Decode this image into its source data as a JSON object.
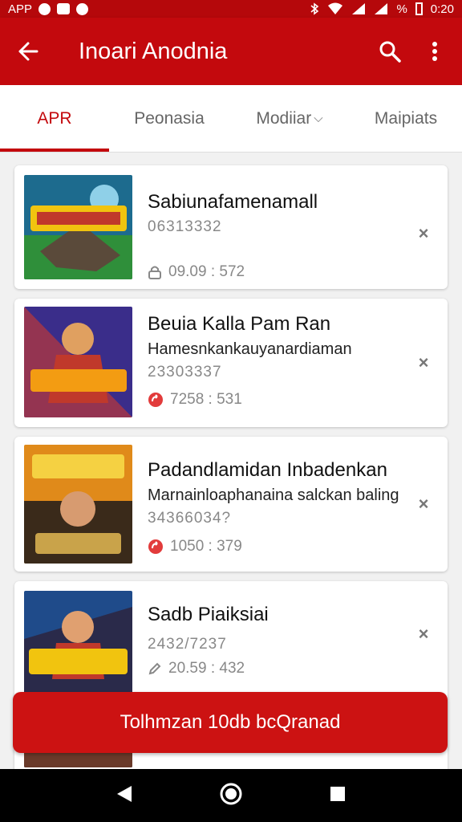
{
  "status_bar": {
    "app_label": "APP",
    "percent": "%",
    "time": "0:20"
  },
  "app_bar": {
    "title": "Inoari Anodnia",
    "back_icon": "arrow-left-icon",
    "search_icon": "search-icon",
    "more_icon": "more-vert-icon"
  },
  "tabs": [
    {
      "label": "APR",
      "active": true
    },
    {
      "label": "Peonasia",
      "active": false
    },
    {
      "label": "Modiiar",
      "active": false,
      "dropdown": true
    },
    {
      "label": "Maipiats",
      "active": false
    }
  ],
  "items": [
    {
      "title": "Sabiunafamenamall",
      "subtitle": "",
      "code": "06313332",
      "meta_icon": "lock-icon",
      "meta": "09.09 : 572"
    },
    {
      "title": "Beuia Kalla Pam Ran",
      "subtitle": "Hamesnkankauyanardiaman",
      "code": "23303337",
      "meta_icon": "refresh-badge-icon",
      "meta": "7258 : 531"
    },
    {
      "title": "Padandlamidan Inbadenkan",
      "subtitle": "Marnainloaphanaina salckan baling",
      "code": "34366034?",
      "meta_icon": "refresh-badge-icon",
      "meta": "1050 : 379"
    },
    {
      "title": "Sadb Piaiksiai",
      "subtitle": "",
      "code": "2432/7237",
      "meta_icon": "pencil-icon",
      "meta": "20.59 : 432"
    }
  ],
  "cta": {
    "label": "Tolhmzan 10db bcQranad"
  },
  "colors": {
    "primary": "#c3090d",
    "status_bar": "#b5080b",
    "cta": "#cc1212"
  }
}
